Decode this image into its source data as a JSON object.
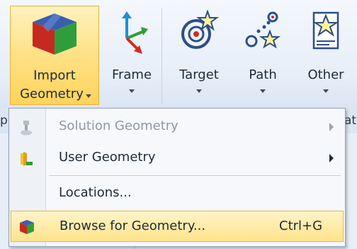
{
  "ribbon": {
    "import_geometry": {
      "line1": "Import",
      "line2": "Geometry"
    },
    "frame": {
      "label": "Frame"
    },
    "target": {
      "label": "Target"
    },
    "path": {
      "label": "Path"
    },
    "other": {
      "label": "Other"
    }
  },
  "groupbar": {
    "left_fragment": "p",
    "right_fragment": "ath"
  },
  "menu": {
    "items": [
      {
        "label": "Solution Geometry",
        "icon": "solution-geometry-icon",
        "enabled": false,
        "submenu": true
      },
      {
        "label": "User Geometry",
        "icon": "user-geometry-icon",
        "enabled": true,
        "submenu": true
      },
      {
        "label": "Locations...",
        "enabled": true,
        "submenu": false
      },
      {
        "label": "Browse for Geometry...",
        "shortcut": "Ctrl+G",
        "icon": "import-geometry-icon",
        "enabled": true,
        "highlighted": true
      }
    ]
  },
  "colors": {
    "highlight": "#ffe38c",
    "highlight_border": "#e2b33c",
    "ribbon_bg": "#e7eef8"
  }
}
